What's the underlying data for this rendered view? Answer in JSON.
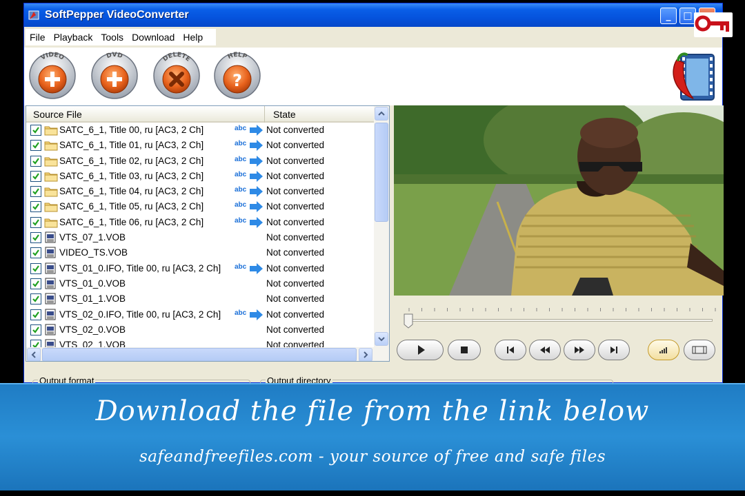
{
  "window": {
    "title": "SoftPepper VideoConverter",
    "min": "_",
    "max": "□",
    "close": "×"
  },
  "menu": [
    "File",
    "Playback",
    "Tools",
    "Download",
    "Help"
  ],
  "toolbar": {
    "video_label": "VIDEO",
    "dvd_label": "DVD",
    "delete_label": "DELETE",
    "help_label": "HELP"
  },
  "filelist": {
    "col_source": "Source File",
    "col_state": "State",
    "rows": [
      {
        "name": "SATC_6_1, Title 00, ru [AC3, 2 Ch]",
        "state": "Not converted",
        "icon": "folder-icon",
        "abc": "abc"
      },
      {
        "name": "SATC_6_1, Title 01, ru [AC3, 2 Ch]",
        "state": "Not converted",
        "icon": "folder-icon",
        "abc": "abc"
      },
      {
        "name": "SATC_6_1, Title 02, ru [AC3, 2 Ch]",
        "state": "Not converted",
        "icon": "folder-icon",
        "abc": "abc"
      },
      {
        "name": "SATC_6_1, Title 03, ru [AC3, 2 Ch]",
        "state": "Not converted",
        "icon": "folder-icon",
        "abc": "abc"
      },
      {
        "name": "SATC_6_1, Title 04, ru [AC3, 2 Ch]",
        "state": "Not converted",
        "icon": "folder-icon",
        "abc": "abc"
      },
      {
        "name": "SATC_6_1, Title 05, ru [AC3, 2 Ch]",
        "state": "Not converted",
        "icon": "folder-icon",
        "abc": "abc"
      },
      {
        "name": "SATC_6_1, Title 06, ru [AC3, 2 Ch]",
        "state": "Not converted",
        "icon": "folder-icon",
        "abc": "abc"
      },
      {
        "name": "VTS_07_1.VOB",
        "state": "Not converted",
        "icon": "film-icon",
        "abc": ""
      },
      {
        "name": "VIDEO_TS.VOB",
        "state": "Not converted",
        "icon": "film-icon",
        "abc": ""
      },
      {
        "name": "VTS_01_0.IFO, Title 00, ru [AC3, 2 Ch]",
        "state": "Not converted",
        "icon": "film-icon",
        "abc": "abc"
      },
      {
        "name": "VTS_01_0.VOB",
        "state": "Not converted",
        "icon": "film-icon",
        "abc": ""
      },
      {
        "name": "VTS_01_1.VOB",
        "state": "Not converted",
        "icon": "film-icon",
        "abc": ""
      },
      {
        "name": "VTS_02_0.IFO, Title 00, ru [AC3, 2 Ch]",
        "state": "Not converted",
        "icon": "film-icon",
        "abc": "abc"
      },
      {
        "name": "VTS_02_0.VOB",
        "state": "Not converted",
        "icon": "film-icon",
        "abc": ""
      },
      {
        "name": "VTS_02_1.VOB",
        "state": "Not converted",
        "icon": "film-icon",
        "abc": ""
      }
    ]
  },
  "output": {
    "format_label": "Output format",
    "directory_label": "Output directory"
  },
  "banner": {
    "title": "Download the file from the link below",
    "subtitle": "safeandfreefiles.com - your source of free and safe files"
  },
  "colors": {
    "titlebar": "#0553dd",
    "orange_button": "#e8621c",
    "banner": "#2a8fd6",
    "abc_blue": "#1a6fd8"
  }
}
